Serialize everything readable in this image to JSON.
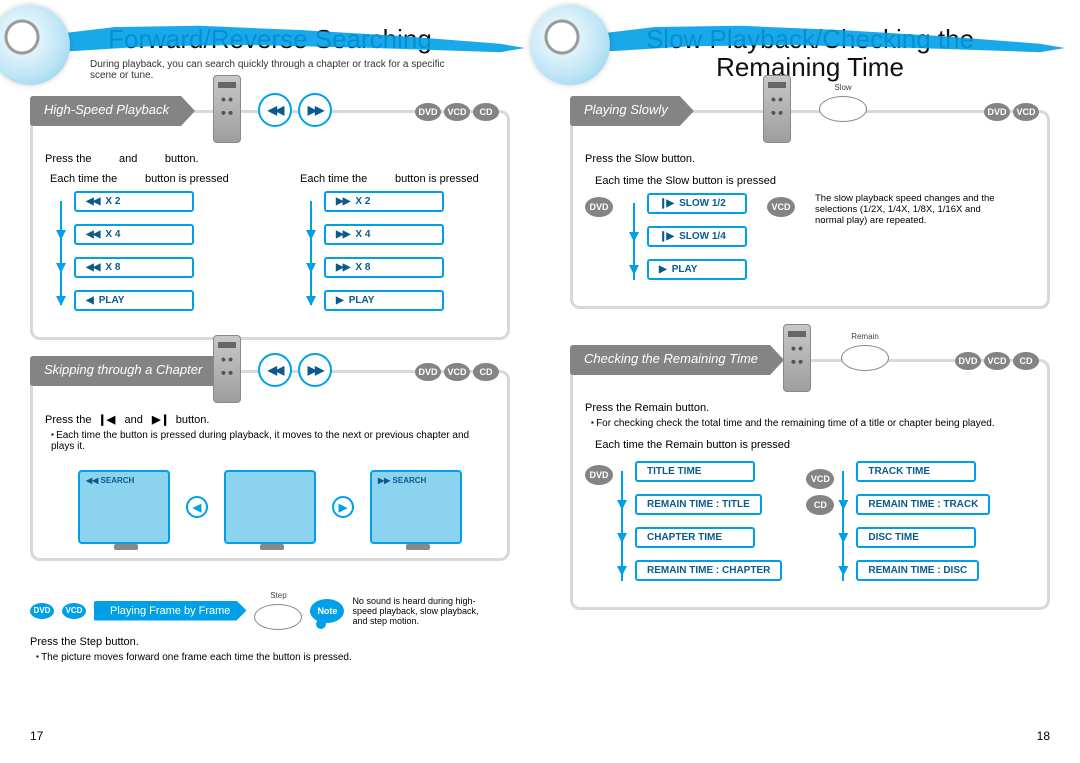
{
  "left": {
    "title": "Forward/Reverse Searching",
    "subtitle": "During playback, you can search quickly through a chapter or track for a specific scene or tune.",
    "page_num": "17",
    "highspeed": {
      "label": "High-Speed Playback",
      "badges": [
        "DVD",
        "VCD",
        "CD"
      ],
      "instr_a": "Press the",
      "instr_b": "and",
      "instr_c": "button.",
      "col_a_hdr1": "Each time the",
      "col_a_hdr2": "button is pressed",
      "col_b_hdr1": "Each time the",
      "col_b_hdr2": "button is pressed",
      "rev_steps": [
        {
          "glyph": "◀◀",
          "label": "X 2"
        },
        {
          "glyph": "◀◀",
          "label": "X 4"
        },
        {
          "glyph": "◀◀",
          "label": "X 8"
        },
        {
          "glyph": "◀",
          "label": "PLAY"
        }
      ],
      "fwd_steps": [
        {
          "glyph": "▶▶",
          "label": "X 2"
        },
        {
          "glyph": "▶▶",
          "label": "X 4"
        },
        {
          "glyph": "▶▶",
          "label": "X 8"
        },
        {
          "glyph": "▶",
          "label": "PLAY"
        }
      ]
    },
    "skipping": {
      "label": "Skipping through a Chapter",
      "badges": [
        "DVD",
        "VCD",
        "CD"
      ],
      "instr_a": "Press the",
      "instr_b": "and",
      "instr_c": "button.",
      "bullet": "Each time the button is pressed during playback, it moves to the next or previous chapter and plays it.",
      "left_tv": "◀◀ SEARCH",
      "right_tv": "▶▶ SEARCH"
    },
    "frame": {
      "badges": [
        "DVD",
        "VCD"
      ],
      "label": "Playing Frame by Frame",
      "step_btn": "Step",
      "instr": "Press the Step button.",
      "bullet": "The picture moves forward one frame each time the button is pressed.",
      "note_label": "Note",
      "note_text": "No sound is heard during high-speed playback, slow playback, and step motion."
    }
  },
  "right": {
    "title_a": "Slow Playback/Checking the",
    "title_b": "Remaining Time",
    "page_num": "18",
    "slow": {
      "label": "Playing Slowly",
      "badges": [
        "DVD",
        "VCD"
      ],
      "slow_btn": "Slow",
      "instr": "Press the Slow button.",
      "sub": "Each time the Slow button is pressed",
      "dvd_steps": [
        {
          "glyph": "❙▶",
          "label": "SLOW 1/2"
        },
        {
          "glyph": "❙▶",
          "label": "SLOW 1/4"
        },
        {
          "glyph": "▶",
          "label": "PLAY"
        }
      ],
      "vcd_note": "The slow playback speed changes and the selections (1/2X, 1/4X, 1/8X, 1/16X and normal play) are repeated."
    },
    "remain": {
      "label": "Checking the Remaining Time",
      "badges": [
        "DVD",
        "VCD",
        "CD"
      ],
      "remain_btn": "Remain",
      "instr": "Press the Remain button.",
      "bullet": "For checking check the total time and the remaining time of a title or chapter being played.",
      "sub": "Each time the Remain button is pressed",
      "dvd_steps": [
        "TITLE TIME",
        "REMAIN TIME : TITLE",
        "CHAPTER TIME",
        "REMAIN TIME : CHAPTER"
      ],
      "vcd_steps": [
        "TRACK TIME",
        "REMAIN TIME : TRACK",
        "DISC TIME",
        "REMAIN TIME : DISC"
      ],
      "dvd_badge": "DVD",
      "vcd_badge": "VCD",
      "cd_badge": "CD"
    }
  }
}
